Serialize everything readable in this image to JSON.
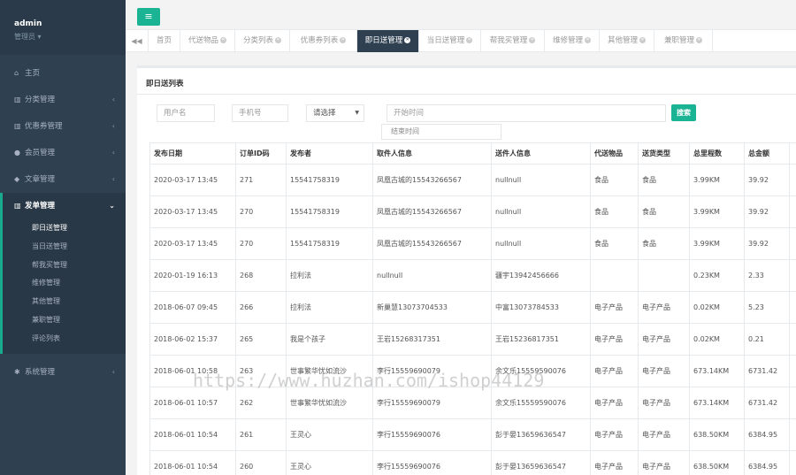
{
  "user": {
    "name": "admin",
    "role": "管理员 ▾"
  },
  "sidebar": {
    "items": [
      {
        "label": "主页",
        "icon": "home-icon",
        "glyph": "⌂"
      },
      {
        "label": "分类管理",
        "icon": "columns-icon",
        "glyph": "▥"
      },
      {
        "label": "优惠券管理",
        "icon": "columns-icon",
        "glyph": "▥"
      },
      {
        "label": "会员管理",
        "icon": "user-icon",
        "glyph": "●"
      },
      {
        "label": "文章管理",
        "icon": "comments-icon",
        "glyph": "◆"
      },
      {
        "label": "发单管理",
        "icon": "columns-icon",
        "glyph": "▥"
      }
    ],
    "submenu": [
      "即日送管理",
      "当日送管理",
      "帮我买管理",
      "维修管理",
      "其他管理",
      "兼职管理",
      "评论列表"
    ],
    "system": {
      "label": "系统管理",
      "icon": "gear-icon",
      "glyph": "✱"
    }
  },
  "tabs": [
    {
      "label": "首页"
    },
    {
      "label": "代送物品"
    },
    {
      "label": "分类列表"
    },
    {
      "label": "优惠券列表"
    },
    {
      "label": "即日送管理"
    },
    {
      "label": "当日送管理"
    },
    {
      "label": "帮我买管理"
    },
    {
      "label": "维修管理"
    },
    {
      "label": "其他管理"
    },
    {
      "label": "兼职管理"
    }
  ],
  "panel": {
    "title": "即日送列表"
  },
  "filters": {
    "username_placeholder": "用户名",
    "phone_placeholder": "手机号",
    "select_value": "请选择",
    "start_time_placeholder": "开始时间",
    "end_time_option": "结束时间",
    "search_label": "搜索"
  },
  "table": {
    "headers": [
      "发布日期",
      "订单ID码",
      "发布者",
      "取件人信息",
      "送件人信息",
      "代送物品",
      "送货类型",
      "总里程数",
      "总金额"
    ],
    "rows": [
      [
        "2020-03-17 13:45",
        "271",
        "15541758319",
        "凤凰古城的15543266567",
        "nullnull",
        "食品",
        "食品",
        "3.99KM",
        "39.92"
      ],
      [
        "2020-03-17 13:45",
        "270",
        "15541758319",
        "凤凰古城的15543266567",
        "nullnull",
        "食品",
        "食品",
        "3.99KM",
        "39.92"
      ],
      [
        "2020-03-17 13:45",
        "270",
        "15541758319",
        "凤凰古城的15543266567",
        "nullnull",
        "食品",
        "食品",
        "3.99KM",
        "39.92"
      ],
      [
        "2020-01-19 16:13",
        "268",
        "拉利法",
        "nullnull",
        "疆宇13942456666",
        "",
        "",
        "0.23KM",
        "2.33"
      ],
      [
        "2018-06-07 09:45",
        "266",
        "拉利法",
        "新巢慧13073704533",
        "中富13073784533",
        "电子产品",
        "电子产品",
        "0.02KM",
        "5.23"
      ],
      [
        "2018-06-02 15:37",
        "265",
        "我是个孩子",
        "王岩15268317351",
        "王岩15236817351",
        "电子产品",
        "电子产品",
        "0.02KM",
        "0.21"
      ],
      [
        "2018-06-01 10:58",
        "263",
        "世事繁华忧如流沙",
        "李行15559690079",
        "余文乐15559590076",
        "电子产品",
        "电子产品",
        "673.14KM",
        "6731.42"
      ],
      [
        "2018-06-01 10:57",
        "262",
        "世事繁华忧如流沙",
        "李行15559690079",
        "余文乐15559590076",
        "电子产品",
        "电子产品",
        "673.14KM",
        "6731.42"
      ],
      [
        "2018-06-01 10:54",
        "261",
        "王灵心",
        "李行15559690076",
        "彭于晏13659636547",
        "电子产品",
        "电子产品",
        "638.50KM",
        "6384.95"
      ],
      [
        "2018-06-01 10:54",
        "260",
        "王灵心",
        "李行15559690076",
        "彭于晏13659636547",
        "电子产品",
        "电子产品",
        "638.50KM",
        "6384.95"
      ]
    ]
  },
  "watermark": "https://www.huzhan.com/ishop44129",
  "colors": {
    "sidebar": "#2f4050",
    "accent": "#1ab394"
  }
}
